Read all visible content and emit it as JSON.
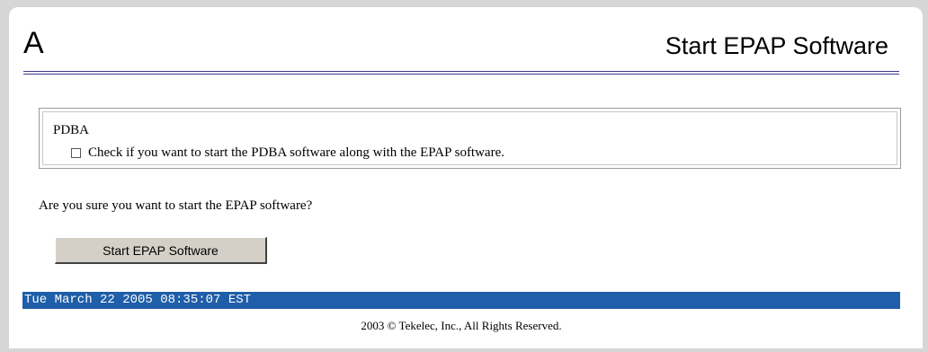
{
  "header": {
    "area_letter": "A",
    "title": "Start EPAP Software"
  },
  "pdba_section": {
    "legend": "PDBA",
    "checkbox_label": "Check if you want to start the PDBA software along with the EPAP software.",
    "checkbox_checked": false
  },
  "confirm": {
    "question": "Are you sure you want to start the EPAP software?",
    "button_label": "Start EPAP Software"
  },
  "status_bar": {
    "timestamp": "Tue March 22 2005 08:35:07 EST"
  },
  "footer": {
    "copyright": "2003 © Tekelec, Inc., All Rights Reserved."
  },
  "colors": {
    "status_bar_bg": "#1f5ea8",
    "title_rule": "#3a3a8a",
    "button_face": "#d4d0c8"
  }
}
